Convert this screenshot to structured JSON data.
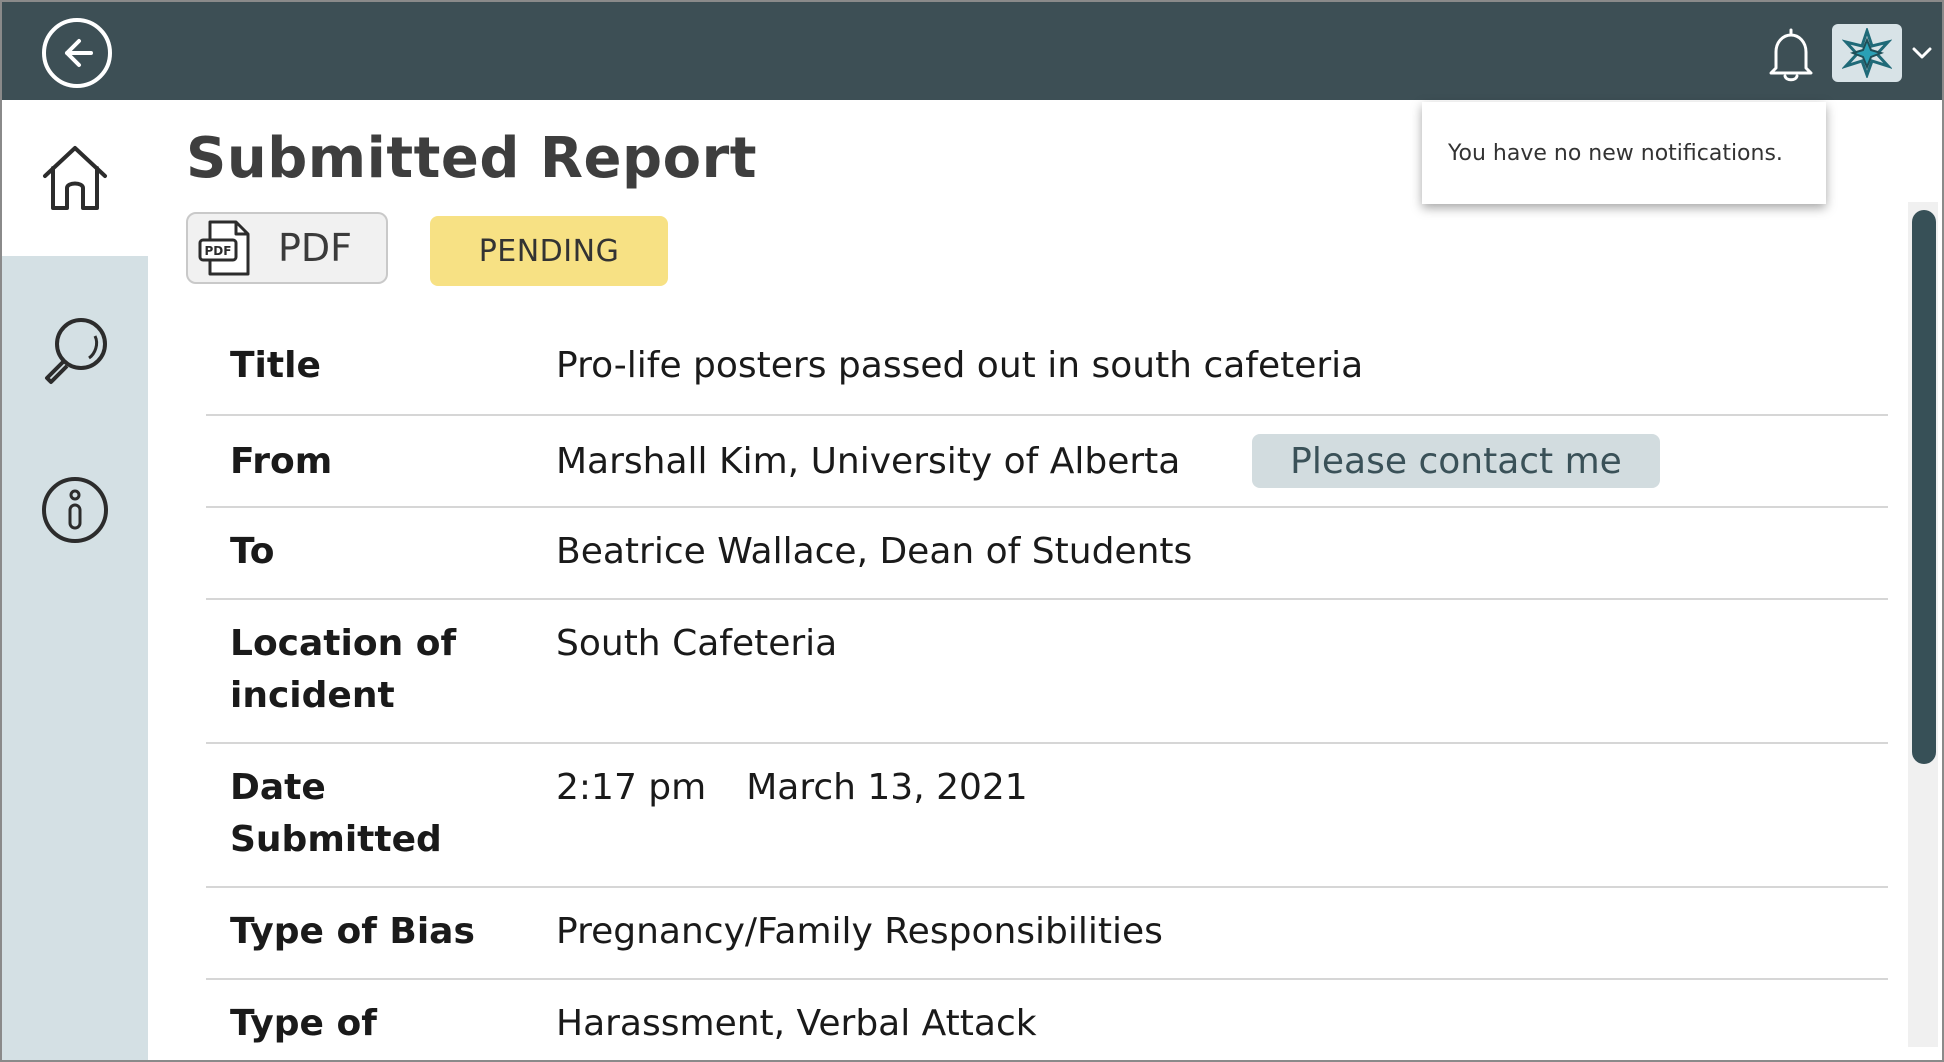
{
  "header": {
    "back_icon": "arrow-left-circle-icon",
    "bell_icon": "bell-icon",
    "avatar_icon": "star-logo-icon",
    "chevron_icon": "chevron-down-icon",
    "bar_color": "#3d4f55"
  },
  "sidebar": {
    "items": [
      {
        "name": "home",
        "icon": "home-icon"
      },
      {
        "name": "search",
        "icon": "search-icon"
      },
      {
        "name": "info",
        "icon": "info-icon"
      }
    ],
    "background": "#d4e0e4"
  },
  "notifications": {
    "message": "You have no new notifications."
  },
  "report": {
    "page_title": "Submitted Report",
    "pdf_label": "PDF",
    "pdf_icon_text": "PDF",
    "status": "PENDING",
    "status_color": "#f7e184",
    "rows": [
      {
        "label": "Title",
        "value": "Pro-life posters passed out in south cafeteria"
      },
      {
        "label": "From",
        "value": "Marshall Kim, University of Alberta",
        "badge": "Please contact me"
      },
      {
        "label": "To",
        "value": "Beatrice Wallace, Dean of Students"
      },
      {
        "label": "Location of incident",
        "value": "South Cafeteria"
      },
      {
        "label": "Date Submitted",
        "time": "2:17 pm",
        "date": "March 13, 2021"
      },
      {
        "label": "Type of Bias",
        "value": "Pregnancy/Family Responsibilities"
      },
      {
        "label": "Type of Incident",
        "value": "Harassment, Verbal Attack"
      }
    ]
  }
}
